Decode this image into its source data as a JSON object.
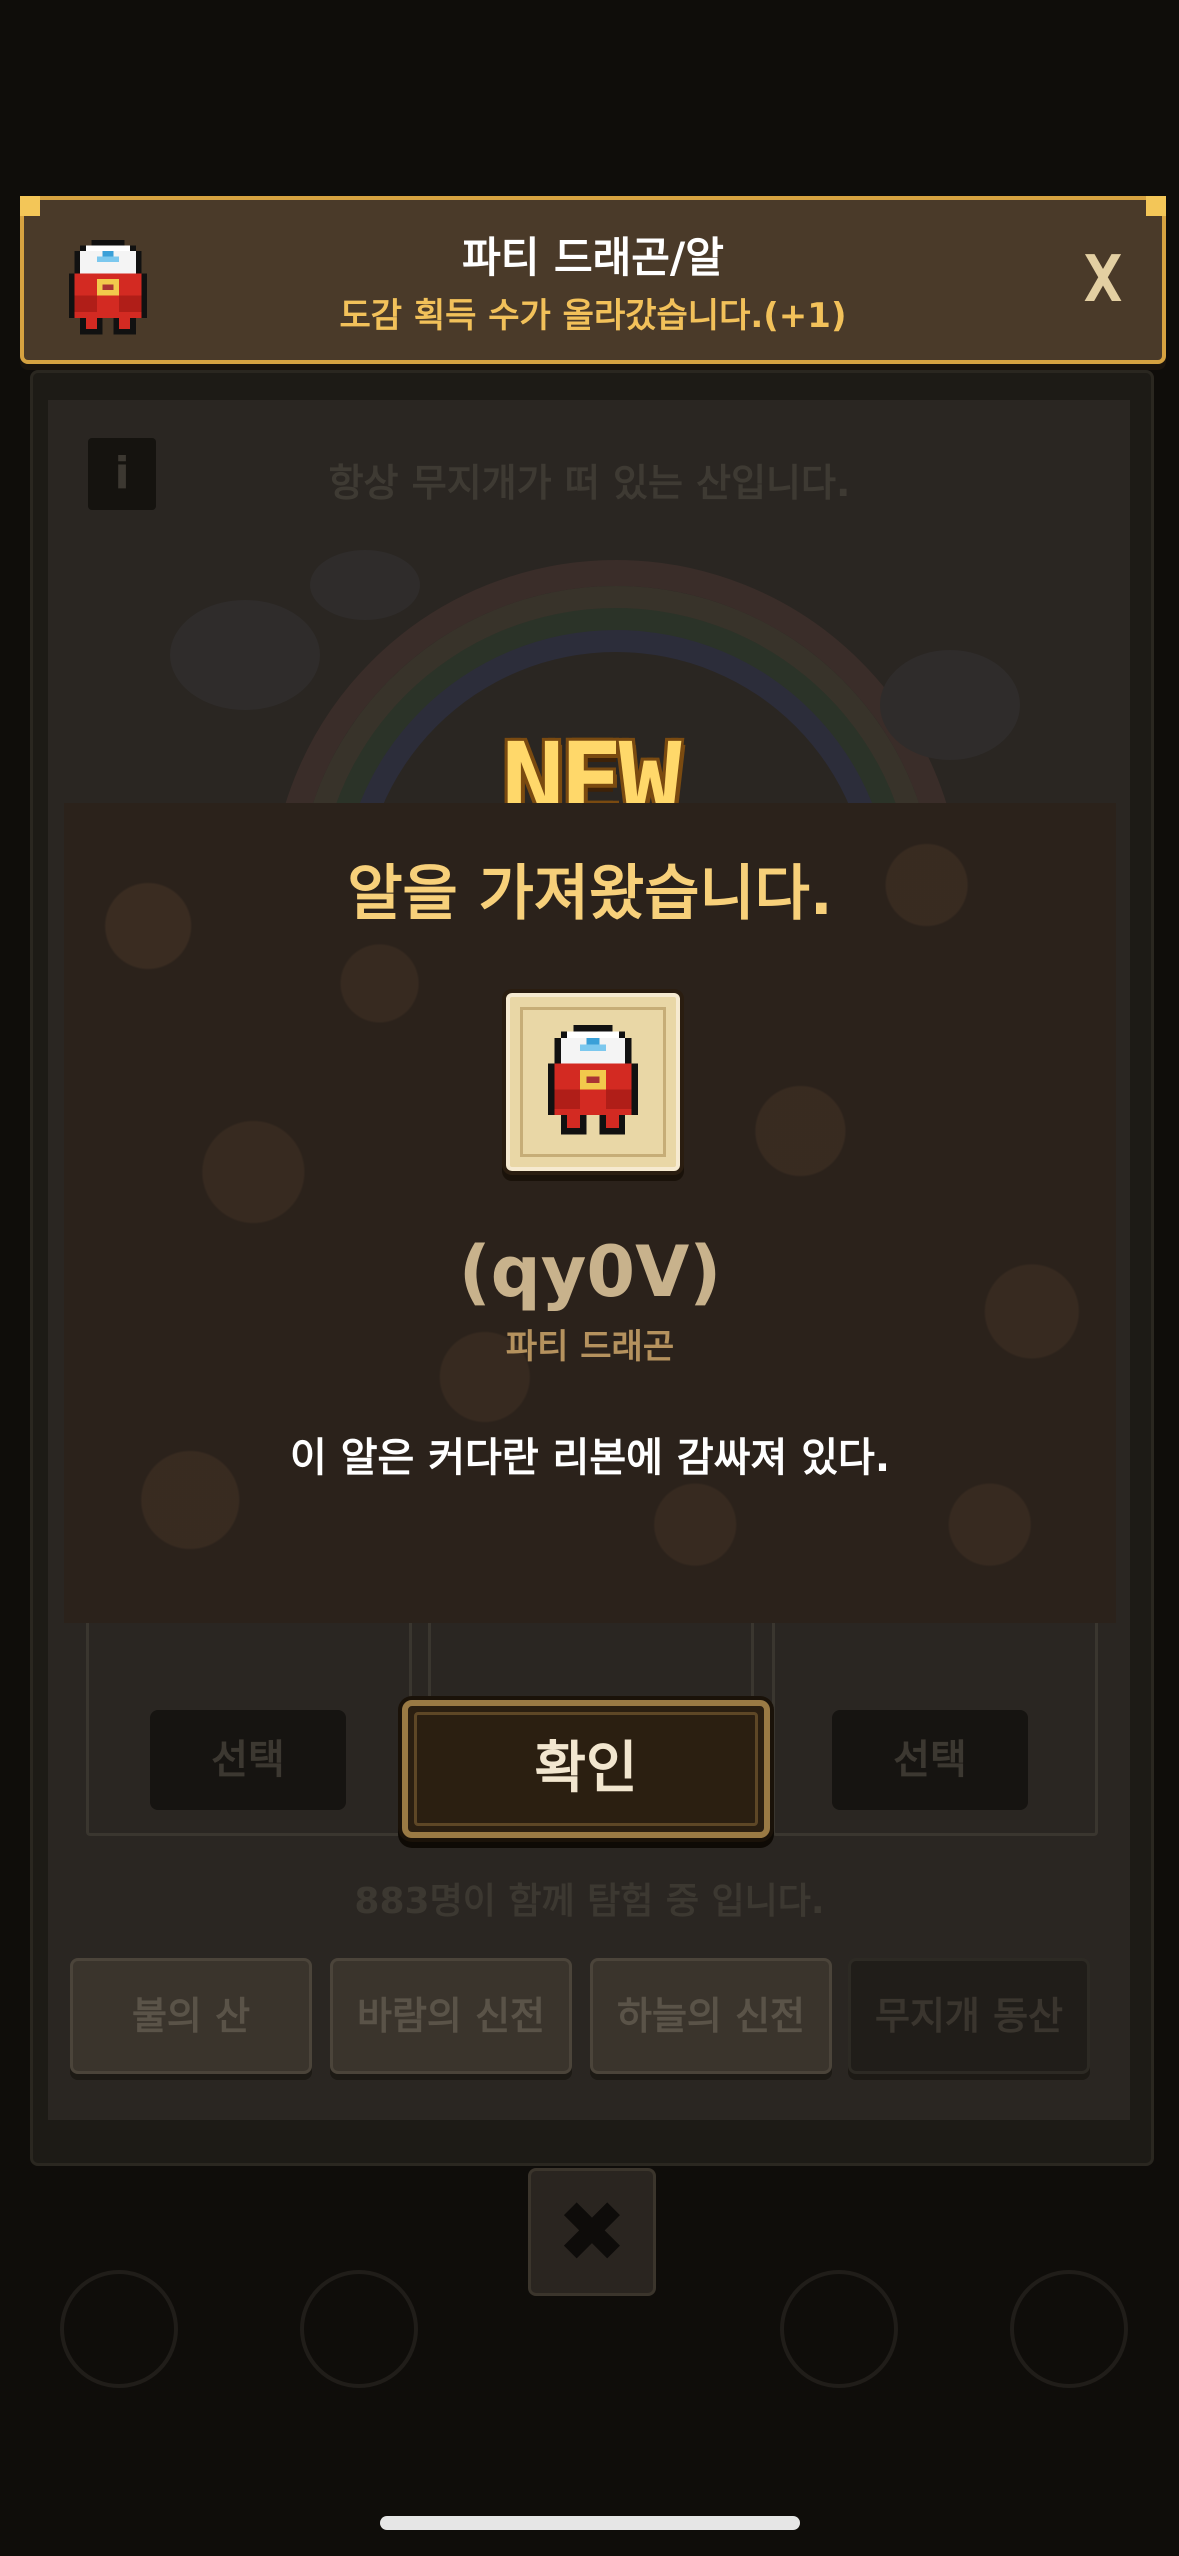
{
  "background": {
    "description_text": "항상 무지개가 떠 있는 산입니다.",
    "info_icon": "i",
    "select_buttons": [
      "선택",
      "선택"
    ],
    "participant_text": "883명이 함께 탐험 중 입니다.",
    "tabs": [
      "불의 산",
      "바람의 신전",
      "하늘의 신전",
      "무지개 동산"
    ],
    "close_glyph": "✖"
  },
  "banner": {
    "title": "파티 드래곤/알",
    "subtitle": "도감 획득 수가 올라갔습니다.(+1)",
    "close_label": "X",
    "icon": "dragon-egg-icon"
  },
  "popup": {
    "new_label": "NEW",
    "title": "알을 가져왔습니다.",
    "egg_code": "(qy0V)",
    "egg_type": "파티 드래곤",
    "egg_description": "이 알은 커다란 리본에 감싸져 있다.",
    "confirm_label": "확인"
  },
  "colors": {
    "accent_gold": "#f7d07a",
    "banner_border": "#d6a240",
    "popup_bg": "#2b221b",
    "egg_red": "#d32a22"
  }
}
